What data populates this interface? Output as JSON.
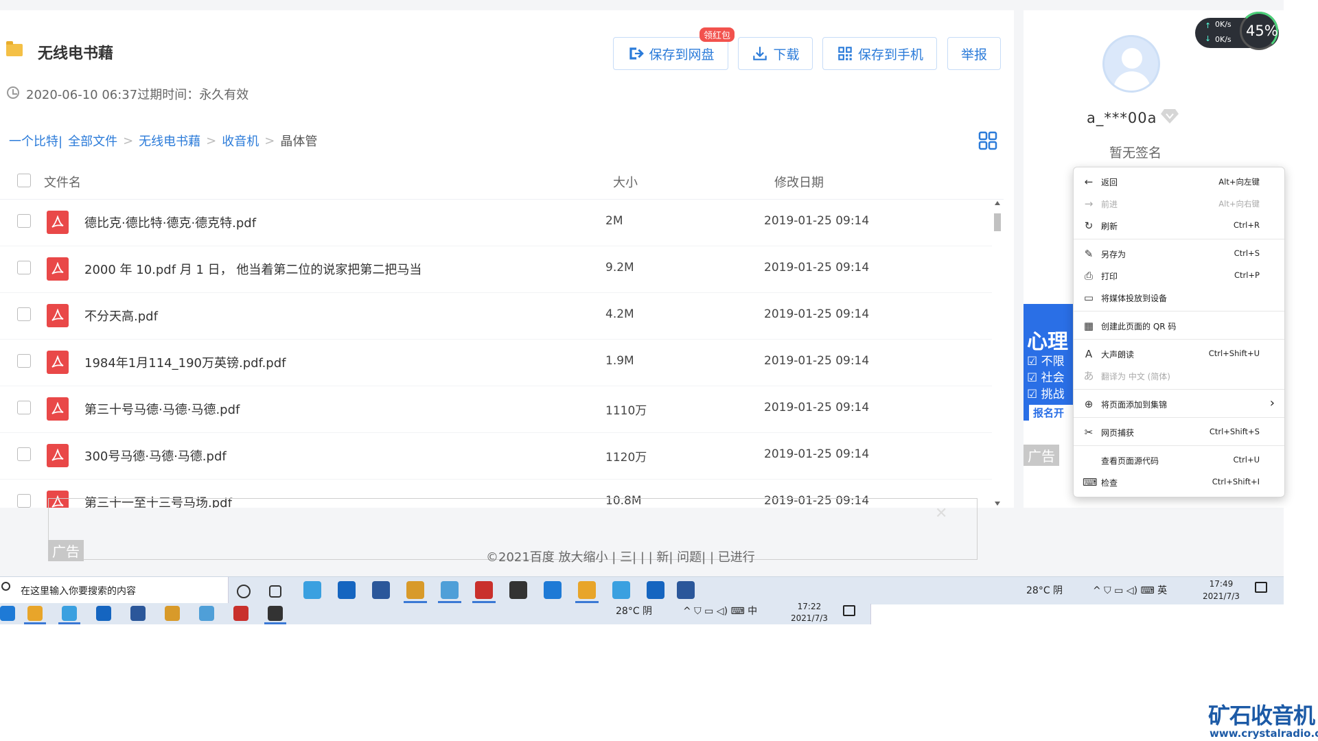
{
  "folder": {
    "title": "无线电书藉",
    "date_line": "2020-06-10 06:37过期时间：永久有效"
  },
  "toolbar": {
    "save_to_pan": "保存到网盘",
    "badge": "领红包",
    "download": "下载",
    "save_to_phone": "保存到手机",
    "report": "举报"
  },
  "breadcrumb": {
    "root": "一个比特|",
    "all_files": "全部文件",
    "sep": ">",
    "level1": "无线电书藉",
    "level2": "收音机",
    "current": "晶体管"
  },
  "table": {
    "col_name": "文件名",
    "col_size": "大小",
    "col_date": "修改日期",
    "rows": [
      {
        "name": "德比克·德比特·德克·德克特.pdf",
        "size": "2M",
        "date": "2019-01-25 09:14"
      },
      {
        "name": "2000 年 10.pdf 月 1 日， 他当着第二位的说家把第二把马当",
        "size": "9.2M",
        "date": "2019-01-25 09:14"
      },
      {
        "name": "不分天高.pdf",
        "size": "4.2M",
        "date": "2019-01-25 09:14"
      },
      {
        "name": "1984年1月114_190万英镑.pdf.pdf",
        "size": "1.9M",
        "date": "2019-01-25 09:14"
      },
      {
        "name": "第三十号马德·马德·马德.pdf",
        "size": "1110万",
        "date": "2019-01-25 09:14"
      },
      {
        "name": "300号马德·马德·马德.pdf",
        "size": "1120万",
        "date": "2019-01-25 09:14"
      },
      {
        "name": "第三十一至十三号马场.pdf",
        "size": "10.8M",
        "date": "2019-01-25 09:14"
      }
    ]
  },
  "ads": {
    "label": "广告",
    "side_title": "心理",
    "side_lines": [
      "☑ 不限",
      "☑ 社会",
      "☑ 挑战"
    ],
    "side_button": "报名开始"
  },
  "footer": "©2021百度 放大缩小 | 三| | | 新| 问题| | 已进行",
  "user": {
    "name": "a_***00a",
    "signature": "暂无签名"
  },
  "speed_widget": {
    "up": "0K/s",
    "down": "0K/s",
    "cpu": "45%"
  },
  "context_menu": {
    "items": [
      {
        "label": "返回",
        "shortcut": "Alt+向左键",
        "icon": "←",
        "disabled": false
      },
      {
        "label": "前进",
        "shortcut": "Alt+向右键",
        "icon": "→",
        "disabled": true
      },
      {
        "label": "刷新",
        "shortcut": "Ctrl+R",
        "icon": "↻",
        "disabled": false
      },
      {
        "label": "另存为",
        "shortcut": "Ctrl+S",
        "icon": "✎",
        "disabled": false
      },
      {
        "label": "打印",
        "shortcut": "Ctrl+P",
        "icon": "⎙",
        "disabled": false
      },
      {
        "label": "将媒体投放到设备",
        "shortcut": "",
        "icon": "▭",
        "disabled": false
      },
      {
        "label": "创建此页面的 QR 码",
        "shortcut": "",
        "icon": "▦",
        "disabled": false
      },
      {
        "label": "大声朗读",
        "shortcut": "Ctrl+Shift+U",
        "icon": "A",
        "disabled": false
      },
      {
        "label": "翻译为 中文 (简体)",
        "shortcut": "",
        "icon": "あ",
        "disabled": true
      },
      {
        "label": "将页面添加到集锦",
        "shortcut": "",
        "icon": "⊕",
        "disabled": false
      },
      {
        "label": "网页捕获",
        "shortcut": "Ctrl+Shift+S",
        "icon": "✂",
        "disabled": false
      },
      {
        "label": "查看页面源代码",
        "shortcut": "Ctrl+U",
        "icon": "",
        "disabled": false
      },
      {
        "label": "检查",
        "shortcut": "Ctrl+Shift+I",
        "icon": "⌨",
        "disabled": false
      }
    ],
    "submenu_arrow": "›"
  },
  "taskbar": {
    "search_placeholder": "在这里输入你要搜索的内容",
    "weather": "28°C 阴",
    "tray": "^ ⛉ ▭ ◁) ⌨ 英",
    "time": "17:49",
    "date": "2021/7/3",
    "second_weather": "28°C 阴",
    "second_tray": "^ ⛉ ▭ ◁) ⌨ 中",
    "second_time": "17:22",
    "second_date": "2021/7/3",
    "icon_colors": [
      "#1e7ad6",
      "#e8a52a",
      "#3aa0e0",
      "#1565c0",
      "#2b579a",
      "#d89a2a",
      "#4f9fd8",
      "#c9302c",
      "#333333"
    ]
  },
  "watermark": {
    "cn": "矿石收音机",
    "url": "www.crystalradio.cn"
  }
}
